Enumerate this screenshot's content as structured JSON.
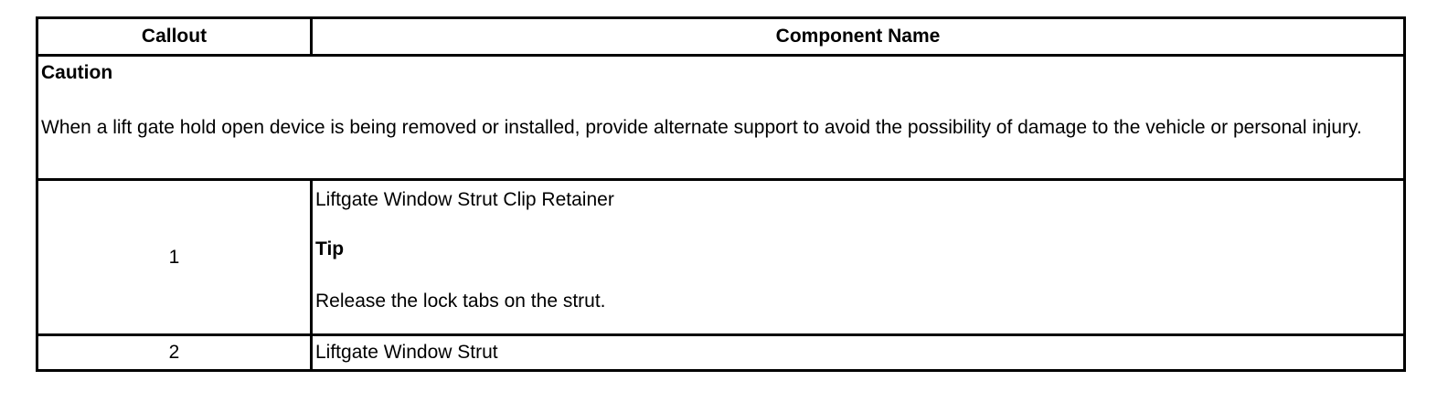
{
  "table": {
    "headers": {
      "callout": "Callout",
      "component": "Component Name"
    },
    "caution": {
      "heading": "Caution",
      "text": "When a lift gate hold open device is being removed or installed, provide alternate support to avoid the possibility of damage to the vehicle or personal injury."
    },
    "rows": [
      {
        "callout": "1",
        "component": "Liftgate Window Strut Clip Retainer",
        "tip_heading": "Tip",
        "tip_text": "Release the lock tabs on the strut."
      },
      {
        "callout": "2",
        "component": "Liftgate Window Strut"
      }
    ]
  }
}
